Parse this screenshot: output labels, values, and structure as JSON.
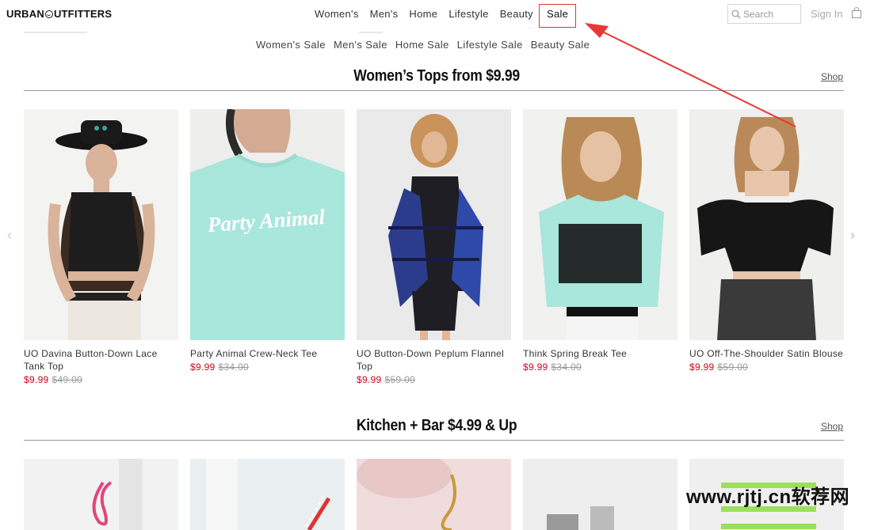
{
  "header": {
    "logo_left": "URBAN",
    "logo_right": "UTFITTERS",
    "nav": [
      "Women's",
      "Men's",
      "Home",
      "Lifestyle",
      "Beauty"
    ],
    "nav_sale": "Sale",
    "search_placeholder": "Search",
    "signin": "Sign In",
    "icons": {
      "search": "magnifier-icon",
      "bag": "shopping-bag-icon"
    }
  },
  "subnav": [
    "Women's Sale",
    "Men's Sale",
    "Home Sale",
    "Lifestyle Sale",
    "Beauty Sale"
  ],
  "sections": [
    {
      "title": "Women’s Tops from $9.99",
      "shop": "Shop",
      "products": [
        {
          "name": "UO Davina Button-Down Lace Tank Top",
          "price": "$9.99",
          "original": "$49.00"
        },
        {
          "name": "Party Animal Crew-Neck Tee",
          "price": "$9.99",
          "original": "$34.00"
        },
        {
          "name": "UO Button-Down Peplum Flannel Top",
          "price": "$9.99",
          "original": "$59.00"
        },
        {
          "name": "Think Spring Break Tee",
          "price": "$9.99",
          "original": "$34.00"
        },
        {
          "name": "UO Off-The-Shoulder Satin Blouse",
          "price": "$9.99",
          "original": "$59.00"
        }
      ]
    },
    {
      "title": "Kitchen + Bar $4.99 & Up",
      "shop": "Shop"
    }
  ],
  "images": {
    "tee_print_text": "Party Animal"
  },
  "carousel": {
    "prev": "‹",
    "next": "›"
  },
  "watermark": "www.rjtj.cn软荐网",
  "colors": {
    "sale_price": "#d0021b",
    "annotation": "#e53935",
    "tee_mint": "#a9e6dc"
  }
}
